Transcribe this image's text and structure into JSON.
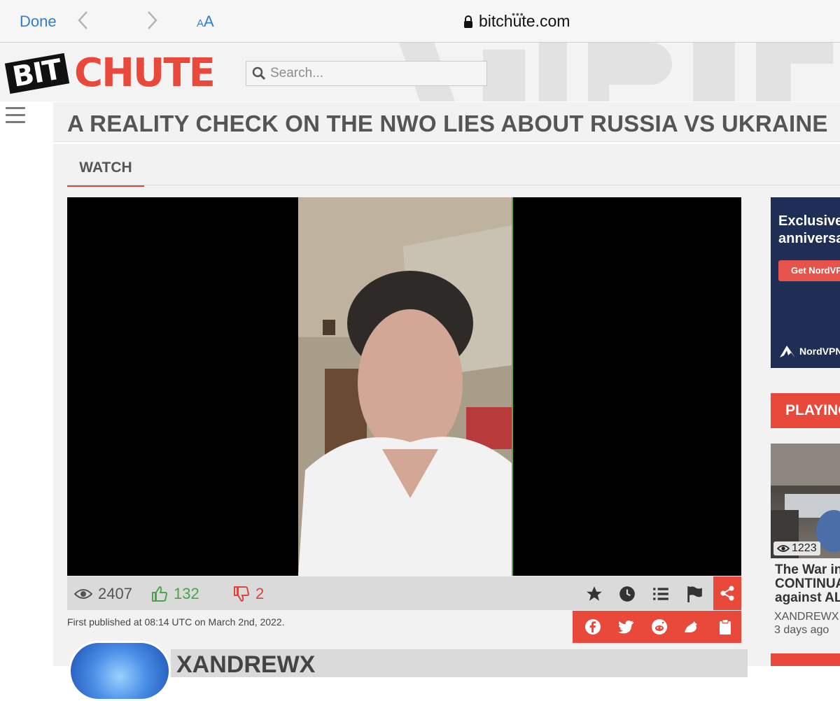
{
  "browser": {
    "done_label": "Done",
    "text_size_small": "A",
    "text_size_large": "A",
    "url": "bitchute.com",
    "more_dots": "•••"
  },
  "site": {
    "logo_bit": "BIT",
    "logo_chute": "CHUTE",
    "search_placeholder": "Search..."
  },
  "video": {
    "title": "A REALITY CHECK ON THE NWO LIES ABOUT RUSSIA VS UKRAINE",
    "tab_label": "WATCH",
    "views": "2407",
    "likes": "132",
    "dislikes": "2",
    "published": "First published at 08:14 UTC on March 2nd, 2022.",
    "channel": "XANDREWX"
  },
  "sidebar": {
    "ad_line1": "Exclusive",
    "ad_line2": "anniversa",
    "ad_button": "Get NordVPN",
    "ad_brand": "NordVPN",
    "playing_label": "PLAYING",
    "next": {
      "views": "1223",
      "title_line1": "The War in",
      "title_line2": "CONTINUA",
      "title_line3": "against AL",
      "channel": "XANDREWX",
      "date": "3 days ago"
    }
  },
  "colors": {
    "brand_red": "#e8493a",
    "like_green": "#4ba34b",
    "safari_blue": "#2f7fd1"
  }
}
